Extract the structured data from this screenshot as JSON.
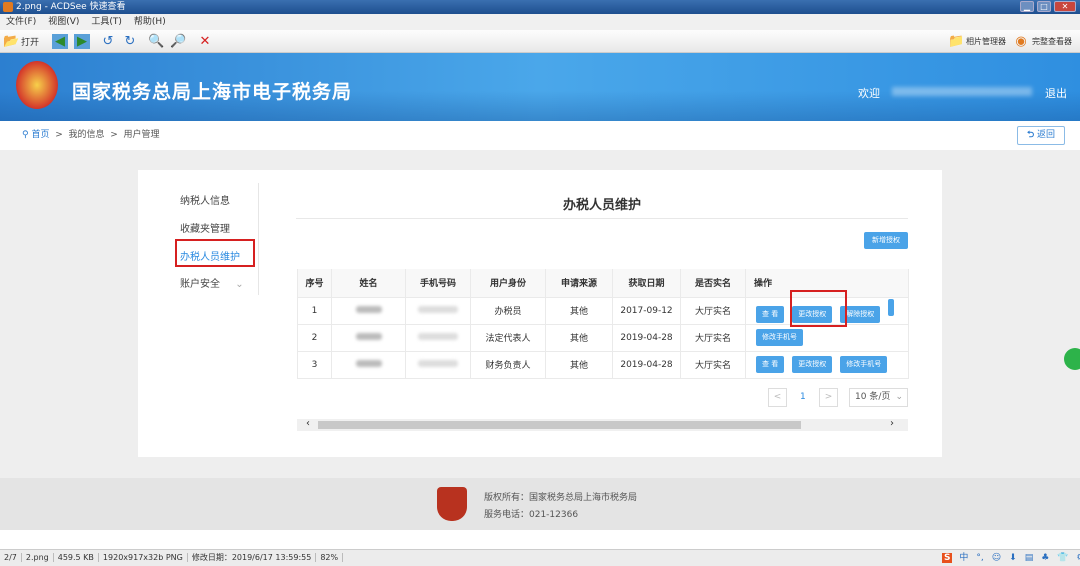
{
  "window": {
    "title": "2.png - ACDSee 快速查看",
    "min": "▁",
    "max": "□",
    "close": "✕"
  },
  "menu": [
    "文件(F)",
    "视图(V)",
    "工具(T)",
    "帮助(H)"
  ],
  "toolbar": {
    "open": "打开",
    "photo_manager": "相片管理器",
    "full_viewer": "完整查看器"
  },
  "banner": {
    "title": "国家税务总局上海市电子税务局",
    "welcome": "欢迎",
    "logout": "退出"
  },
  "breadcrumb": {
    "home": "首页",
    "sep": ">",
    "items": [
      "我的信息",
      "用户管理"
    ],
    "back": "返回"
  },
  "sidenav": [
    "纳税人信息",
    "收藏夹管理",
    "办税人员维护",
    "账户安全"
  ],
  "main": {
    "heading": "办税人员维护",
    "add_button": "新增授权",
    "columns": [
      "序号",
      "姓名",
      "手机号码",
      "用户身份",
      "申请来源",
      "获取日期",
      "是否实名",
      "操作"
    ],
    "rows": [
      {
        "no": "1",
        "role": "办税员",
        "source": "其他",
        "date": "2017-09-12",
        "realname": "大厅实名",
        "actions": [
          "查 看",
          "更改授权",
          "解除授权"
        ]
      },
      {
        "no": "2",
        "role": "法定代表人",
        "source": "其他",
        "date": "2019-04-28",
        "realname": "大厅实名",
        "actions": [
          "修改手机号"
        ]
      },
      {
        "no": "3",
        "role": "财务负责人",
        "source": "其他",
        "date": "2019-04-28",
        "realname": "大厅实名",
        "actions": [
          "查 看",
          "更改授权",
          "修改手机号"
        ]
      }
    ],
    "pagination": {
      "prev": "<",
      "page": "1",
      "next": ">",
      "page_size": "10 条/页"
    }
  },
  "footer": {
    "copyright": "版权所有：国家税务总局上海市税务局",
    "phone": "服务电话：021-12366"
  },
  "status": [
    "2/7",
    "2.png",
    "459.5 KB",
    "1920x917x32b PNG",
    "修改日期：2019/6/17 13:59:55",
    "82%"
  ],
  "tray": [
    "中",
    "°,",
    "☺",
    "⬇",
    "▤",
    "♣",
    "👕",
    "⚙"
  ]
}
